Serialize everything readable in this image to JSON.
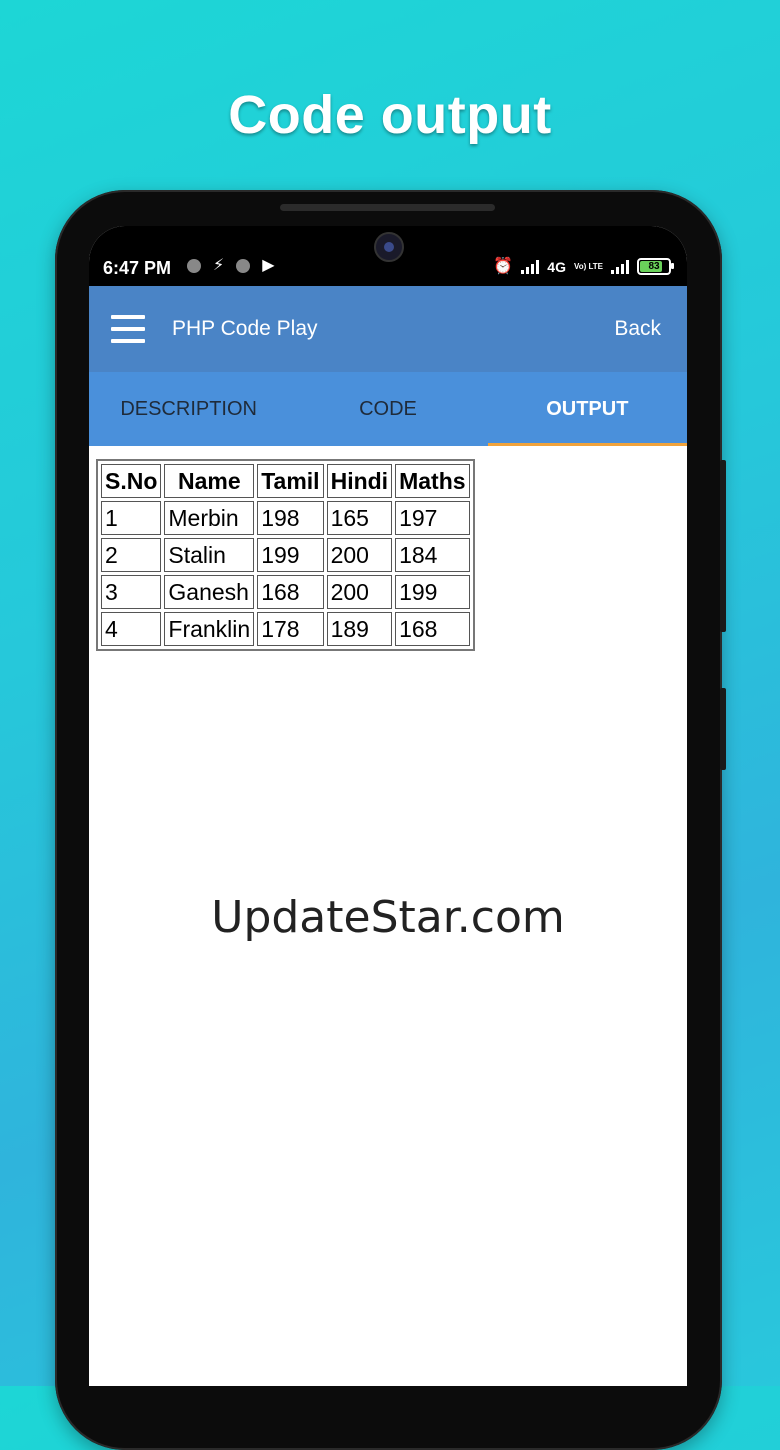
{
  "promo": {
    "title": "Code output"
  },
  "statusbar": {
    "time": "6:47 PM",
    "network": "4G",
    "volte": "Vo) LTE",
    "battery": "83"
  },
  "appbar": {
    "title": "PHP Code Play",
    "back_label": "Back"
  },
  "tabs": [
    {
      "label": "DESCRIPTION",
      "active": false
    },
    {
      "label": "CODE",
      "active": false
    },
    {
      "label": "OUTPUT",
      "active": true
    }
  ],
  "table": {
    "headers": [
      "S.No",
      "Name",
      "Tamil",
      "Hindi",
      "Maths"
    ],
    "rows": [
      [
        "1",
        "Merbin",
        "198",
        "165",
        "197"
      ],
      [
        "2",
        "Stalin",
        "199",
        "200",
        "184"
      ],
      [
        "3",
        "Ganesh",
        "168",
        "200",
        "199"
      ],
      [
        "4",
        "Franklin",
        "178",
        "189",
        "168"
      ]
    ]
  },
  "watermark": "UpdateStar.com",
  "colors": {
    "appbar": "#4a84c6",
    "tabbar": "#4a90db",
    "tab_indicator": "#f1a33b",
    "battery_fill": "#6ad15a"
  },
  "icons": [
    "menu-icon",
    "clock-icon",
    "flash-icon",
    "play-store-icon",
    "alarm-icon",
    "signal-icon",
    "battery-icon"
  ]
}
